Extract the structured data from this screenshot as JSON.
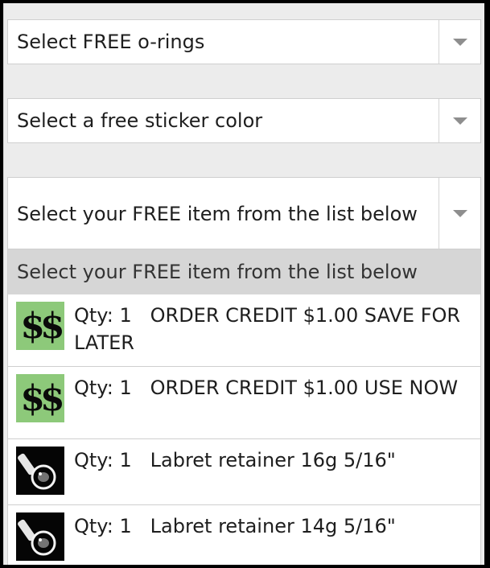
{
  "selects": [
    {
      "label": "Select FREE o-rings"
    },
    {
      "label": "Select a free sticker color"
    },
    {
      "label": "Select your FREE item from the list below"
    }
  ],
  "dropdown": {
    "header": "Select your FREE item from the list below",
    "options": [
      {
        "label": "Qty: 1   ORDER CREDIT $1.00 SAVE FOR LATER",
        "icon": "dollar-sign-icon",
        "icon_text": "$$"
      },
      {
        "label": "Qty: 1   ORDER CREDIT $1.00 USE NOW",
        "icon": "dollar-sign-icon",
        "icon_text": "$$"
      },
      {
        "label": "Qty: 1   Labret retainer 16g 5/16\"",
        "icon": "labret-retainer-icon"
      },
      {
        "label": "Qty: 1   Labret retainer 14g 5/16\"",
        "icon": "labret-retainer-icon"
      }
    ]
  },
  "colors": {
    "page_bg": "#ececec",
    "money_green": "#8dc97a",
    "header_gray": "#d6d6d6",
    "arrow_gray": "#8e8e8e"
  }
}
